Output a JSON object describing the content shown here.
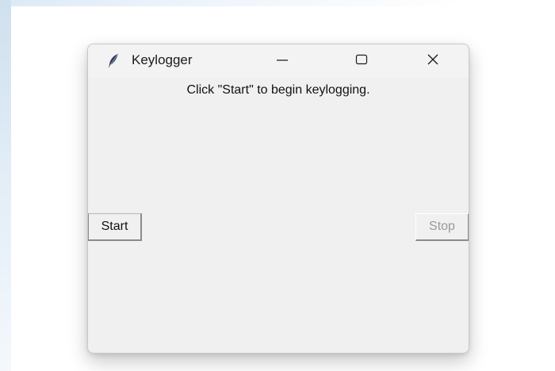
{
  "window": {
    "title": "Keylogger",
    "app_icon": "feather-icon",
    "controls": {
      "minimize_icon": "minimize-icon",
      "maximize_icon": "maximize-icon",
      "close_icon": "close-icon"
    }
  },
  "content": {
    "instruction": "Click \"Start\" to begin keylogging.",
    "start_button": {
      "label": "Start",
      "enabled": true
    },
    "stop_button": {
      "label": "Stop",
      "enabled": false
    }
  },
  "colors": {
    "window_background": "#f0f0f0",
    "text": "#111111",
    "disabled_text": "#9a9a9a"
  }
}
